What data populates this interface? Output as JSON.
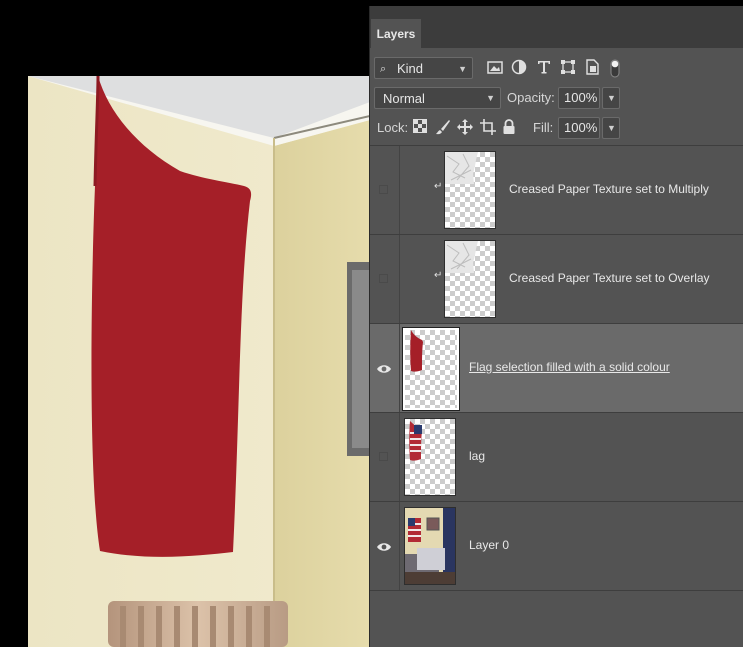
{
  "panel": {
    "tab_label": "Layers",
    "filter": {
      "kind_label": "Kind",
      "icons": [
        "image-filter-icon",
        "adjustment-filter-icon",
        "type-filter-icon",
        "shape-filter-icon",
        "smart-object-filter-icon",
        "filter-toggle-icon"
      ]
    },
    "blend_mode": "Normal",
    "opacity_label": "Opacity:",
    "opacity_value": "100%",
    "lock_label": "Lock:",
    "lock_icons": [
      "lock-transparent-icon",
      "lock-paint-icon",
      "lock-position-icon",
      "lock-artboard-icon",
      "lock-all-icon"
    ],
    "fill_label": "Fill:",
    "fill_value": "100%"
  },
  "layers": [
    {
      "name": "Creased Paper Texture set to Multiply",
      "visible": false,
      "clipped": true,
      "selected": false,
      "thumb": "paper"
    },
    {
      "name": "Creased Paper Texture set to Overlay",
      "visible": false,
      "clipped": true,
      "selected": false,
      "thumb": "paper"
    },
    {
      "name": "Flag selection filled with a solid colour",
      "visible": true,
      "clipped": false,
      "selected": true,
      "thumb": "redflag"
    },
    {
      "name": "lag",
      "visible": false,
      "clipped": false,
      "selected": false,
      "thumb": "usflag"
    },
    {
      "name": "Layer 0",
      "visible": true,
      "clipped": false,
      "selected": false,
      "thumb": "room"
    }
  ],
  "colors": {
    "panel_bg": "#535353",
    "selected_row": "#6a6a6a",
    "flag_red": "#a51f28",
    "wall": "#efe6c2"
  }
}
